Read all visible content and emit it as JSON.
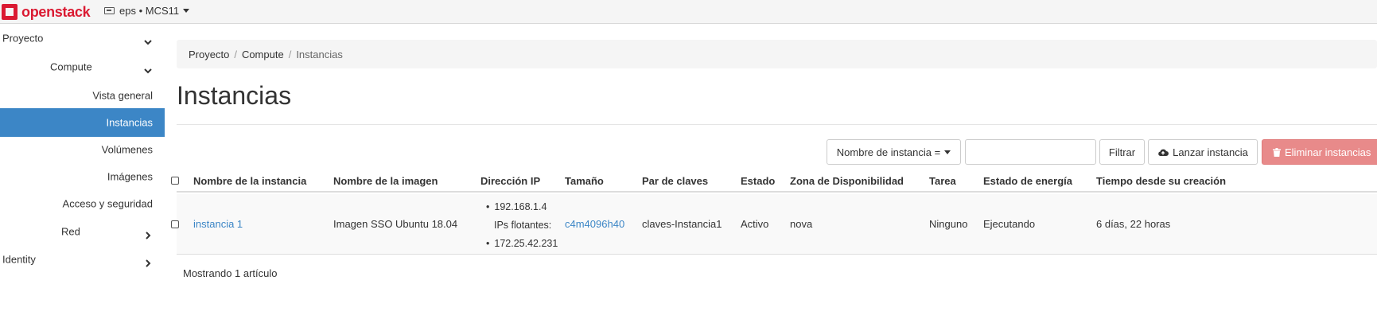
{
  "topbar": {
    "brand": "openstack",
    "project_menu": "eps • MCS11"
  },
  "sidebar": {
    "proyecto": "Proyecto",
    "compute": "Compute",
    "items": [
      {
        "label": "Vista general"
      },
      {
        "label": "Instancias",
        "active": true
      },
      {
        "label": "Volúmenes"
      },
      {
        "label": "Imágenes"
      },
      {
        "label": "Acceso y seguridad"
      }
    ],
    "red": "Red",
    "identity": "Identity"
  },
  "breadcrumb": {
    "items": [
      "Proyecto",
      "Compute",
      "Instancias"
    ],
    "separator": "/"
  },
  "page": {
    "title": "Instancias"
  },
  "toolbar": {
    "filter_select": "Nombre de instancia =",
    "filter_input_value": "",
    "filter_button": "Filtrar",
    "launch_button": "Lanzar instancia",
    "delete_button": "Eliminar instancias"
  },
  "table": {
    "columns": [
      "Nombre de la instancia",
      "Nombre de la imagen",
      "Dirección IP",
      "Tamaño",
      "Par de claves",
      "Estado",
      "Zona de Disponibilidad",
      "Tarea",
      "Estado de energía",
      "Tiempo desde su creación"
    ],
    "rows": [
      {
        "name": "instancia 1",
        "image": "Imagen SSO Ubuntu 18.04",
        "ip_fixed": "192.168.1.4",
        "ip_floating_label": "IPs flotantes:",
        "ip_floating": "172.25.42.231",
        "size": "c4m4096h40",
        "keypair": "claves-Instancia1",
        "status": "Activo",
        "zone": "nova",
        "task": "Ninguno",
        "power": "Ejecutando",
        "age": "6 días, 22 horas"
      }
    ],
    "footer": "Mostrando 1 artículo"
  },
  "colors": {
    "brand_red": "#da1a32",
    "active_blue": "#3c86c6",
    "link_blue": "#3c86c6",
    "danger_button": "#e88a8a"
  }
}
